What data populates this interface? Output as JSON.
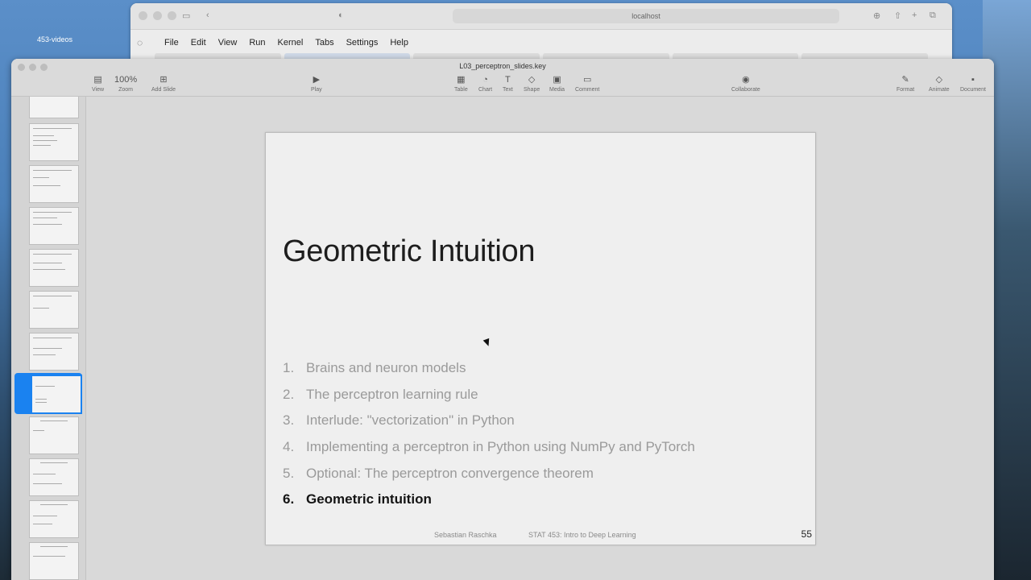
{
  "desktop": {
    "label": "453-videos"
  },
  "browser": {
    "url": "localhost",
    "menu": [
      "File",
      "Edit",
      "View",
      "Run",
      "Kernel",
      "Tabs",
      "Settings",
      "Help"
    ]
  },
  "keynote": {
    "window_title": "L03_perceptron_slides.key",
    "toolbar": {
      "view": "View",
      "zoom_value": "100%",
      "zoom": "Zoom",
      "add_slide": "Add Slide",
      "play": "Play",
      "table": "Table",
      "chart": "Chart",
      "text": "Text",
      "shape": "Shape",
      "media": "Media",
      "comment": "Comment",
      "collaborate": "Collaborate",
      "format": "Format",
      "animate": "Animate",
      "document": "Document"
    },
    "slide": {
      "title": "Geometric Intuition",
      "agenda": [
        {
          "num": "1.",
          "text": "Brains and neuron models"
        },
        {
          "num": "2.",
          "text": "The perceptron learning rule"
        },
        {
          "num": "3.",
          "text": "Interlude: \"vectorization\" in Python"
        },
        {
          "num": "4.",
          "text": "Implementing a perceptron in Python using NumPy and PyTorch"
        },
        {
          "num": "5.",
          "text": "Optional: The perceptron convergence theorem"
        },
        {
          "num": "6.",
          "text": "Geometric intuition"
        }
      ],
      "footer_author": "Sebastian Raschka",
      "footer_course": "STAT 453: Intro to Deep Learning",
      "page_number": "55"
    }
  },
  "colors": {
    "selection": "#1a82f0",
    "inactive_agenda": "#9a9a9a",
    "active_agenda": "#141414"
  }
}
